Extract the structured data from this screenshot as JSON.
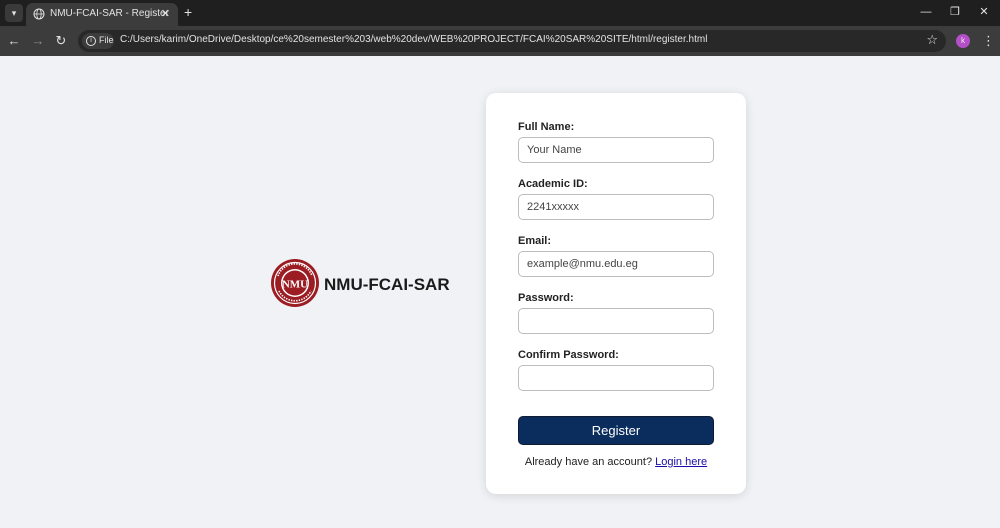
{
  "browser": {
    "tab_title": "NMU-FCAI-SAR - Register",
    "tab_close": "✕",
    "new_tab": "+",
    "chip_label": "File",
    "url": "C:/Users/karim/OneDrive/Desktop/ce%20semester%203/web%20dev/WEB%20PROJECT/FCAI%20SAR%20SITE/html/register.html",
    "profile_initial": "k"
  },
  "brand": {
    "name": "NMU-FCAI-SAR",
    "logo_monogram": "NMU"
  },
  "form": {
    "full_name_label": "Full Name:",
    "full_name_placeholder": "Your Name",
    "academic_id_label": "Academic ID:",
    "academic_id_placeholder": "2241xxxxx",
    "email_label": "Email:",
    "email_placeholder": "example@nmu.edu.eg",
    "password_label": "Password:",
    "confirm_password_label": "Confirm Password:",
    "register_label": "Register",
    "login_prompt": "Already have an account?",
    "login_link": "Login here"
  },
  "colors": {
    "accent": "#0a2d5e",
    "logo_red": "#9b1c22",
    "page_bg": "#f0f2f5"
  }
}
